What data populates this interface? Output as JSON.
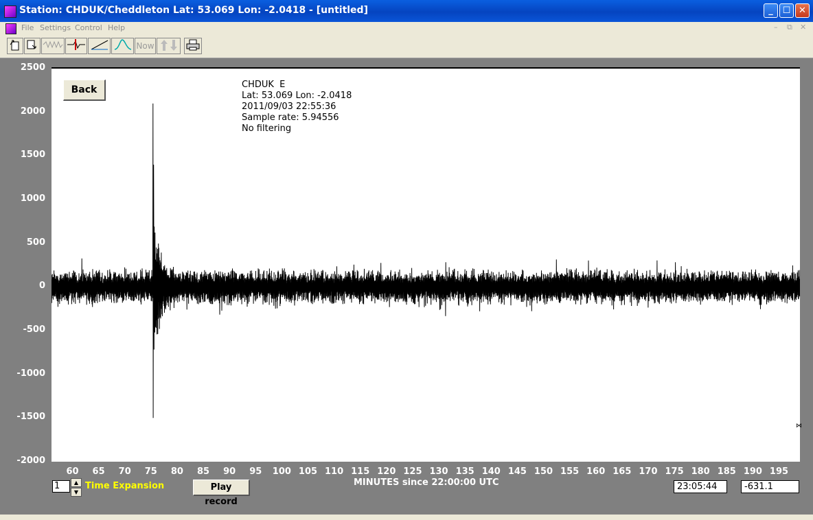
{
  "window": {
    "title": "Station: CHDUK/Cheddleton Lat: 53.069 Lon: -2.0418 - [untitled]",
    "min": "_",
    "max": "☐",
    "close": "✕"
  },
  "menu": {
    "items": [
      "File",
      "Settings",
      "Control",
      "Help"
    ],
    "mdi": [
      "–",
      "⧉",
      "✕"
    ]
  },
  "toolbar": {
    "now_label": "Now"
  },
  "info": {
    "line1": "CHDUK  E",
    "line2": "Lat: 53.069 Lon: -2.0418",
    "line3": "2011/09/03 22:55:36",
    "line4": "Sample rate: 5.94556",
    "line5": "No filtering"
  },
  "back_label": "Back",
  "chart_data": {
    "type": "line",
    "xlabel": "MINUTES since 22:00:00 UTC",
    "ylabel": "",
    "xlim": [
      56,
      199
    ],
    "ylim": [
      -2000,
      2500
    ],
    "yticks": [
      "2500",
      "2000",
      "1500",
      "1000",
      "500",
      "0",
      "-500",
      "-1000",
      "-1500",
      "-2000"
    ],
    "xticks": [
      "60",
      "65",
      "70",
      "75",
      "80",
      "85",
      "90",
      "95",
      "100",
      "105",
      "110",
      "115",
      "120",
      "125",
      "130",
      "135",
      "140",
      "145",
      "150",
      "155",
      "160",
      "165",
      "170",
      "175",
      "180",
      "185",
      "190",
      "195"
    ],
    "event": {
      "onset_minute": 75.4,
      "peak": 2100,
      "trough": -1500,
      "second_peak": 1400
    },
    "noise_amplitude": 220,
    "line_color": "#000000"
  },
  "controls": {
    "expansion_value": "1",
    "time_expansion_label": "Time Expansion",
    "play_label": "Play record",
    "time_readout": "23:05:44",
    "value_readout": "-631.1"
  }
}
